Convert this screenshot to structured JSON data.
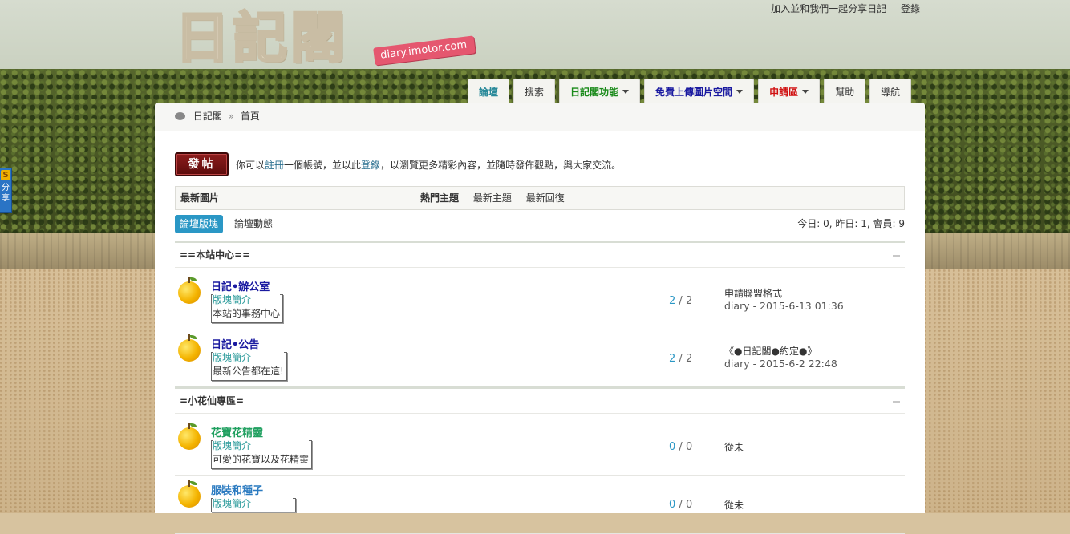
{
  "header": {
    "logo_text": "日記閣",
    "logo_tagline": "diary.imotor.com",
    "top_links": [
      "加入並和我們一起分享日記",
      "登錄"
    ]
  },
  "nav": {
    "tabs": [
      {
        "label": "論壇",
        "color": "#2a8a9a",
        "bold": true,
        "dropdown": false
      },
      {
        "label": "搜索",
        "color": "#333333",
        "bold": false,
        "dropdown": false
      },
      {
        "label": "日記閣功能",
        "color": "#1a8a1a",
        "bold": true,
        "dropdown": true
      },
      {
        "label": "免費上傳圖片空間",
        "color": "#1a1aa0",
        "bold": true,
        "dropdown": true
      },
      {
        "label": "申請區",
        "color": "#d01010",
        "bold": true,
        "dropdown": true
      },
      {
        "label": "幫助",
        "color": "#333333",
        "bold": false,
        "dropdown": false
      },
      {
        "label": "導航",
        "color": "#333333",
        "bold": false,
        "dropdown": false
      }
    ]
  },
  "breadcrumb": {
    "site": "日記閣",
    "sep": "»",
    "current": "首頁"
  },
  "post": {
    "button_label": "發帖",
    "msg_1": "你可以",
    "register_link": "註冊",
    "msg_2": "一個帳號，並以此",
    "login_link": "登錄",
    "msg_3": "，以瀏覽更多精彩內容，並隨時發佈觀點，與大家交流。"
  },
  "hot_bar": {
    "left_label": "最新圖片",
    "tabs": [
      "熱門主題",
      "最新主題",
      "最新回復"
    ]
  },
  "sub": {
    "active_tab": "論壇版塊",
    "other_tab": "論壇動態",
    "stats": "今日: 0, 昨日: 1, 會員: 9"
  },
  "categories": [
    {
      "title": "==本站中心==",
      "forums": [
        {
          "name": "日記•辦公室",
          "name_color": "#1a1aa0",
          "legend": "版塊簡介",
          "desc": "本站的事務中心",
          "threads": "2",
          "posts": "2",
          "last_title": "申請聯盟格式",
          "last_meta": "diary - 2015-6-13 01:36"
        },
        {
          "name": "日記•公告",
          "name_color": "#1a1aa0",
          "legend": "版塊簡介",
          "desc": "最新公告都在這!",
          "threads": "2",
          "posts": "2",
          "last_title": "《●日記閣●約定●》",
          "last_meta": "diary - 2015-6-2 22:48"
        }
      ]
    },
    {
      "title": "=小花仙專區=",
      "forums": [
        {
          "name": "花寶花精靈",
          "name_color": "#20a060",
          "legend": "版塊簡介",
          "desc": "可愛的花寶以及花精靈",
          "threads": "0",
          "posts": "0",
          "last_title": "從未",
          "last_meta": ""
        },
        {
          "name": "服裝和種子",
          "name_color": "#2a7ac0",
          "legend": "版塊簡介",
          "desc": "",
          "threads": "0",
          "posts": "0",
          "last_title": "從未",
          "last_meta": ""
        }
      ]
    }
  ],
  "share_widget": {
    "icon": "S",
    "label": "分享"
  }
}
